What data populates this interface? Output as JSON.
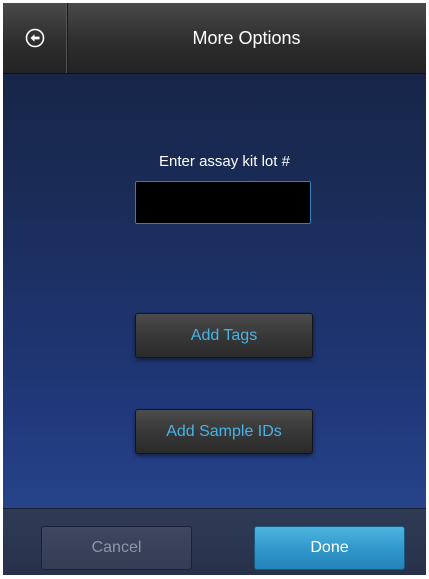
{
  "header": {
    "title": "More Options",
    "back_icon": "back-arrow-circle-icon"
  },
  "form": {
    "lot_label": "Enter assay kit lot #",
    "lot_value": ""
  },
  "actions": {
    "add_tags_label": "Add Tags",
    "add_sample_ids_label": "Add Sample IDs"
  },
  "footer": {
    "cancel_label": "Cancel",
    "done_label": "Done"
  },
  "colors": {
    "accent_text": "#45b4e8",
    "done_button": "#2f96c9",
    "input_border": "#2f7fb8"
  }
}
